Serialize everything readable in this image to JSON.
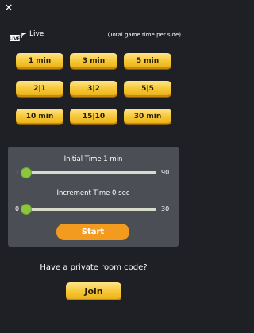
{
  "close_icon": "✕",
  "live": {
    "icon": "live-broadcast-icon",
    "label": "Live",
    "subtitle": "(Total game time per side)"
  },
  "time_controls": [
    {
      "label": "1 min"
    },
    {
      "label": "3 min"
    },
    {
      "label": "5 min"
    },
    {
      "label": "2|1"
    },
    {
      "label": "3|2"
    },
    {
      "label": "5|5"
    },
    {
      "label": "10 min"
    },
    {
      "label": "15|10"
    },
    {
      "label": "30 min"
    }
  ],
  "custom": {
    "initial": {
      "label": "Initial Time 1 min",
      "min": "1",
      "max": "90",
      "value": 1,
      "min_value": 1,
      "max_value": 90
    },
    "increment": {
      "label": "Increment Time 0 sec",
      "min": "0",
      "max": "30",
      "value": 0,
      "min_value": 0,
      "max_value": 30
    },
    "start_label": "Start"
  },
  "private_room": {
    "prompt": "Have a private room code?",
    "join_label": "Join"
  },
  "colors": {
    "background": "#1e2026",
    "panel": "#4b4e55",
    "gold": "#f5c531",
    "orange": "#f39b1e",
    "slider_thumb": "#8cc63f"
  }
}
